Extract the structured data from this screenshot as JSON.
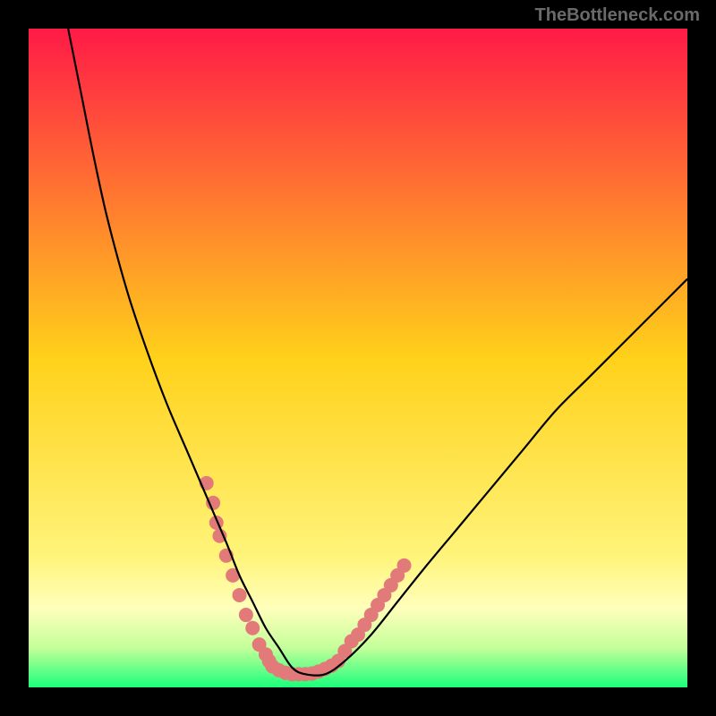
{
  "watermark": "TheBottleneck.com",
  "chart_data": {
    "type": "line",
    "title": "",
    "xlabel": "",
    "ylabel": "",
    "xlim": [
      0,
      100
    ],
    "ylim": [
      0,
      100
    ],
    "grid": false,
    "legend": false,
    "gradient_stops": [
      {
        "offset": 0.0,
        "color": "#ff1a47"
      },
      {
        "offset": 0.5,
        "color": "#ffd11a"
      },
      {
        "offset": 0.8,
        "color": "#fff47a"
      },
      {
        "offset": 0.88,
        "color": "#ffffbb"
      },
      {
        "offset": 0.94,
        "color": "#c4ff9a"
      },
      {
        "offset": 1.0,
        "color": "#1aff7a"
      }
    ],
    "series": [
      {
        "name": "curve",
        "color": "#000000",
        "x": [
          6,
          8,
          10,
          12,
          15,
          18,
          21,
          24,
          27,
          30,
          32,
          34,
          36,
          38,
          40,
          42,
          45,
          48,
          52,
          56,
          60,
          65,
          70,
          75,
          80,
          85,
          90,
          95,
          100
        ],
        "y": [
          100,
          90,
          80,
          71,
          60,
          51,
          43,
          36,
          29,
          22,
          17,
          13,
          9,
          6,
          3,
          2,
          2,
          4,
          8,
          13,
          18,
          24,
          30,
          36,
          42,
          47,
          52,
          57,
          62
        ]
      }
    ],
    "scatter": {
      "name": "dots",
      "color": "#e37a7a",
      "radius": 8,
      "points": [
        {
          "x": 27,
          "y": 31
        },
        {
          "x": 28,
          "y": 28
        },
        {
          "x": 28.5,
          "y": 25
        },
        {
          "x": 29,
          "y": 23
        },
        {
          "x": 30,
          "y": 20
        },
        {
          "x": 31,
          "y": 17
        },
        {
          "x": 32,
          "y": 14
        },
        {
          "x": 33,
          "y": 11
        },
        {
          "x": 34,
          "y": 9
        },
        {
          "x": 35,
          "y": 6.5
        },
        {
          "x": 36,
          "y": 5
        },
        {
          "x": 36.5,
          "y": 4
        },
        {
          "x": 37,
          "y": 3.2
        },
        {
          "x": 38,
          "y": 2.6
        },
        {
          "x": 39,
          "y": 2.2
        },
        {
          "x": 40,
          "y": 2.0
        },
        {
          "x": 41,
          "y": 2.0
        },
        {
          "x": 42,
          "y": 2.0
        },
        {
          "x": 43,
          "y": 2.1
        },
        {
          "x": 44,
          "y": 2.4
        },
        {
          "x": 45,
          "y": 2.8
        },
        {
          "x": 46,
          "y": 3.3
        },
        {
          "x": 47,
          "y": 4.0
        },
        {
          "x": 48,
          "y": 5.5
        },
        {
          "x": 49,
          "y": 7.0
        },
        {
          "x": 50,
          "y": 8.0
        },
        {
          "x": 51,
          "y": 9.5
        },
        {
          "x": 52,
          "y": 11
        },
        {
          "x": 53,
          "y": 12.5
        },
        {
          "x": 54,
          "y": 14
        },
        {
          "x": 55,
          "y": 15.5
        },
        {
          "x": 56,
          "y": 17
        },
        {
          "x": 57,
          "y": 18.5
        }
      ]
    }
  }
}
